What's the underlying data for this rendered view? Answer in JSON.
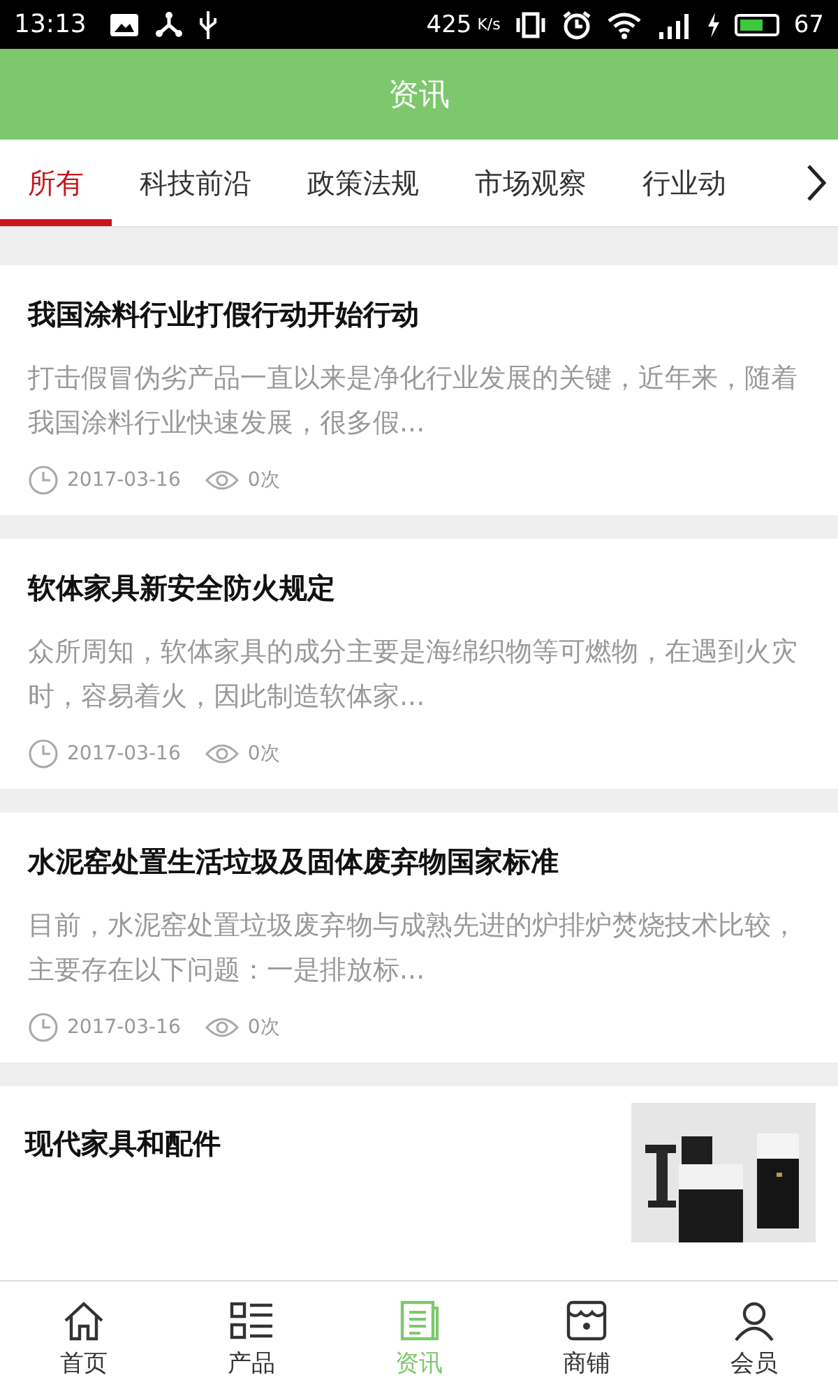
{
  "status_bar": {
    "time": "13:13",
    "speed": "425",
    "speed_unit": "K/s",
    "battery": "67"
  },
  "header": {
    "title": "资讯"
  },
  "tabs": [
    {
      "label": "所有",
      "selected": true
    },
    {
      "label": "科技前沿",
      "selected": false
    },
    {
      "label": "政策法规",
      "selected": false
    },
    {
      "label": "市场观察",
      "selected": false
    },
    {
      "label": "行业动",
      "selected": false
    }
  ],
  "articles": [
    {
      "kind": "text",
      "title": "我国涂料行业打假行动开始行动",
      "summary": "打击假冒伪劣产品一直以来是净化行业发展的关键，近年来，随着我国涂料行业快速发展，很多假...",
      "date": "2017-03-16",
      "views": "0次"
    },
    {
      "kind": "text",
      "title": "软体家具新安全防火规定",
      "summary": "众所周知，软体家具的成分主要是海绵织物等可燃物，在遇到火灾时，容易着火，因此制造软体家...",
      "date": "2017-03-16",
      "views": "0次"
    },
    {
      "kind": "text",
      "title": "水泥窑处置生活垃圾及固体废弃物国家标准",
      "summary": "目前，水泥窑处置垃圾废弃物与成熟先进的炉排炉焚烧技术比较，主要存在以下问题：一是排放标...",
      "date": "2017-03-16",
      "views": "0次"
    },
    {
      "kind": "picture",
      "title": "现代家具和配件"
    }
  ],
  "bottom_nav": [
    {
      "label": "首页",
      "kind": "home",
      "selected": false
    },
    {
      "label": "产品",
      "kind": "list",
      "selected": false
    },
    {
      "label": "资讯",
      "kind": "news",
      "selected": true
    },
    {
      "label": "商铺",
      "kind": "shop",
      "selected": false
    },
    {
      "label": "会员",
      "kind": "user",
      "selected": false
    }
  ]
}
